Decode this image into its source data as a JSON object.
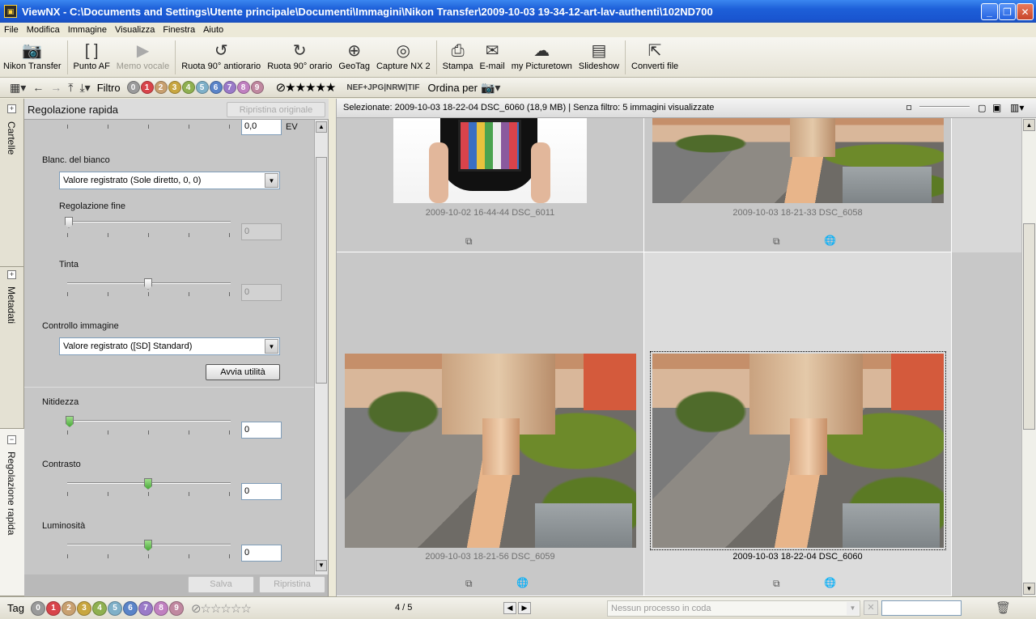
{
  "window": {
    "title": "ViewNX - C:\\Documents and Settings\\Utente principale\\Documenti\\Immagini\\Nikon Transfer\\2009-10-03 19-34-12-art-lav-authenti\\102ND700",
    "app_icon": "viewnx-app-icon"
  },
  "menu": [
    "File",
    "Modifica",
    "Immagine",
    "Visualizza",
    "Finestra",
    "Aiuto"
  ],
  "toolbar": [
    {
      "label": "Nikon Transfer",
      "icon": "camera-transfer-icon"
    },
    {
      "label": "Punto AF",
      "icon": "af-point-icon"
    },
    {
      "label": "Memo vocale",
      "icon": "voice-memo-icon",
      "disabled": true
    },
    {
      "label": "Ruota 90° antiorario",
      "icon": "rotate-ccw-icon"
    },
    {
      "label": "Ruota 90° orario",
      "icon": "rotate-cw-icon"
    },
    {
      "label": "GeoTag",
      "icon": "geotag-icon"
    },
    {
      "label": "Capture NX 2",
      "icon": "capture-nx-icon"
    },
    {
      "label": "Stampa",
      "icon": "print-icon"
    },
    {
      "label": "E-mail",
      "icon": "email-icon"
    },
    {
      "label": "my Picturetown",
      "icon": "picturetown-icon"
    },
    {
      "label": "Slideshow",
      "icon": "slideshow-icon"
    },
    {
      "label": "Converti file",
      "icon": "convert-file-icon"
    }
  ],
  "filterbar": {
    "filter_label": "Filtro",
    "labels": [
      "0",
      "1",
      "2",
      "3",
      "4",
      "5",
      "6",
      "7",
      "8",
      "9"
    ],
    "label_colors": [
      "#9a9a9a",
      "#d8444a",
      "#c8a070",
      "#c8a640",
      "#8fb050",
      "#7fb0c8",
      "#5a84c8",
      "#9a7ac8",
      "#c080c0",
      "#c088a0"
    ],
    "file_types": "NEF+JPG|NRW|TIF",
    "sort_label": "Ordina per"
  },
  "left_tabs": [
    {
      "label": "Cartelle",
      "state": "+"
    },
    {
      "label": "Metadati",
      "state": "+"
    },
    {
      "label": "Regolazione rapida",
      "state": "−"
    }
  ],
  "quick_adjust": {
    "title": "Regolazione rapida",
    "reset_original": "Ripristina originale",
    "ev_value": "0,0",
    "ev_unit": "EV",
    "wb_label": "Blanc. del bianco",
    "wb_value": "Valore registrato (Sole diretto, 0, 0)",
    "fine_label": "Regolazione fine",
    "fine_value": "0",
    "tint_label": "Tinta",
    "tint_value": "0",
    "pc_label": "Controllo immagine",
    "pc_value": "Valore registrato ([SD] Standard)",
    "launch_button": "Avvia utilità",
    "sharp_label": "Nitidezza",
    "sharp_value": "0",
    "contrast_label": "Contrasto",
    "contrast_value": "0",
    "bright_label": "Luminosità",
    "bright_value": "0",
    "save_button": "Salva",
    "reset_button": "Ripristina"
  },
  "main": {
    "header_text": "Selezionate: 2009-10-03 18-22-04 DSC_6060 (18,9 MB) | Senza filtro: 5 immagini visualizzate",
    "thumbnails": [
      {
        "caption": "2009-10-02 16-44-44 DSC_6011",
        "selected": false
      },
      {
        "caption": "2009-10-03 18-21-33 DSC_6058",
        "selected": false
      },
      {
        "caption": "2009-10-03 18-21-56 DSC_6059",
        "selected": false
      },
      {
        "caption": "2009-10-03 18-22-04 DSC_6060",
        "selected": true
      }
    ]
  },
  "status": {
    "tag_label": "Tag",
    "page_count": "4 / 5",
    "queue_placeholder": "Nessun processo in coda"
  }
}
